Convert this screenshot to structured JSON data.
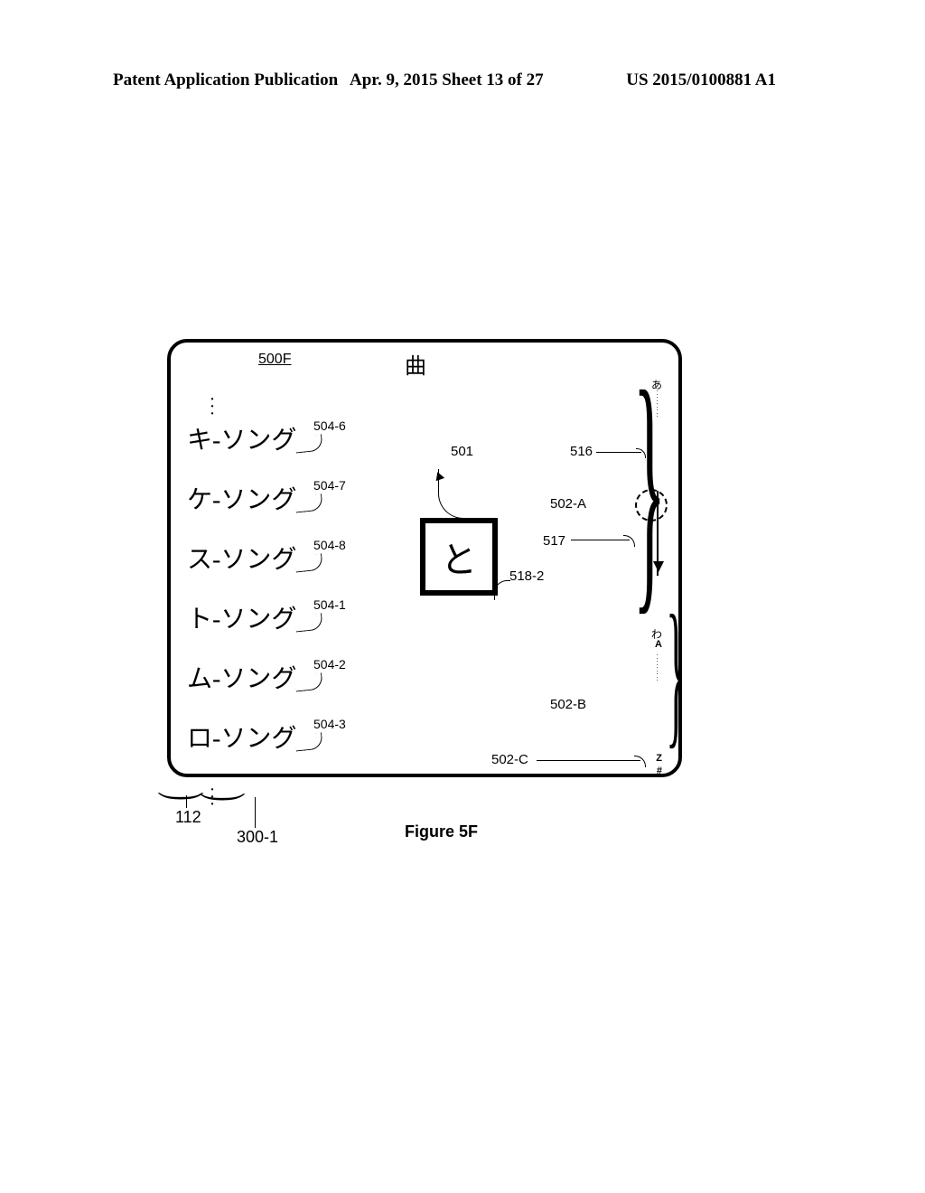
{
  "header": {
    "left": "Patent Application Publication",
    "center": "Apr. 9, 2015  Sheet 13 of 27",
    "pubno": "US 2015/0100881 A1"
  },
  "figure": {
    "id": "500F",
    "title": "曲",
    "caption": "Figure 5F"
  },
  "songs": [
    {
      "text": "キ-ソング",
      "ref": "504-6"
    },
    {
      "text": "ケ-ソング",
      "ref": "504-7"
    },
    {
      "text": "ス-ソング",
      "ref": "504-8"
    },
    {
      "text": "ト-ソング",
      "ref": "504-1"
    },
    {
      "text": "ム-ソング",
      "ref": "504-2"
    },
    {
      "text": "ロ-ソング",
      "ref": "504-3"
    }
  ],
  "popup": {
    "char": "と"
  },
  "index": {
    "top": "あ",
    "bottom_kana": "わ",
    "A": "A",
    "Z": "Z",
    "hash": "#"
  },
  "refs": {
    "r501": "501",
    "r516": "516",
    "r517": "517",
    "r518_2": "518-2",
    "r502a": "502-A",
    "r502b": "502-B",
    "r502c": "502-C",
    "r112": "112",
    "r300_1": "300-1"
  }
}
